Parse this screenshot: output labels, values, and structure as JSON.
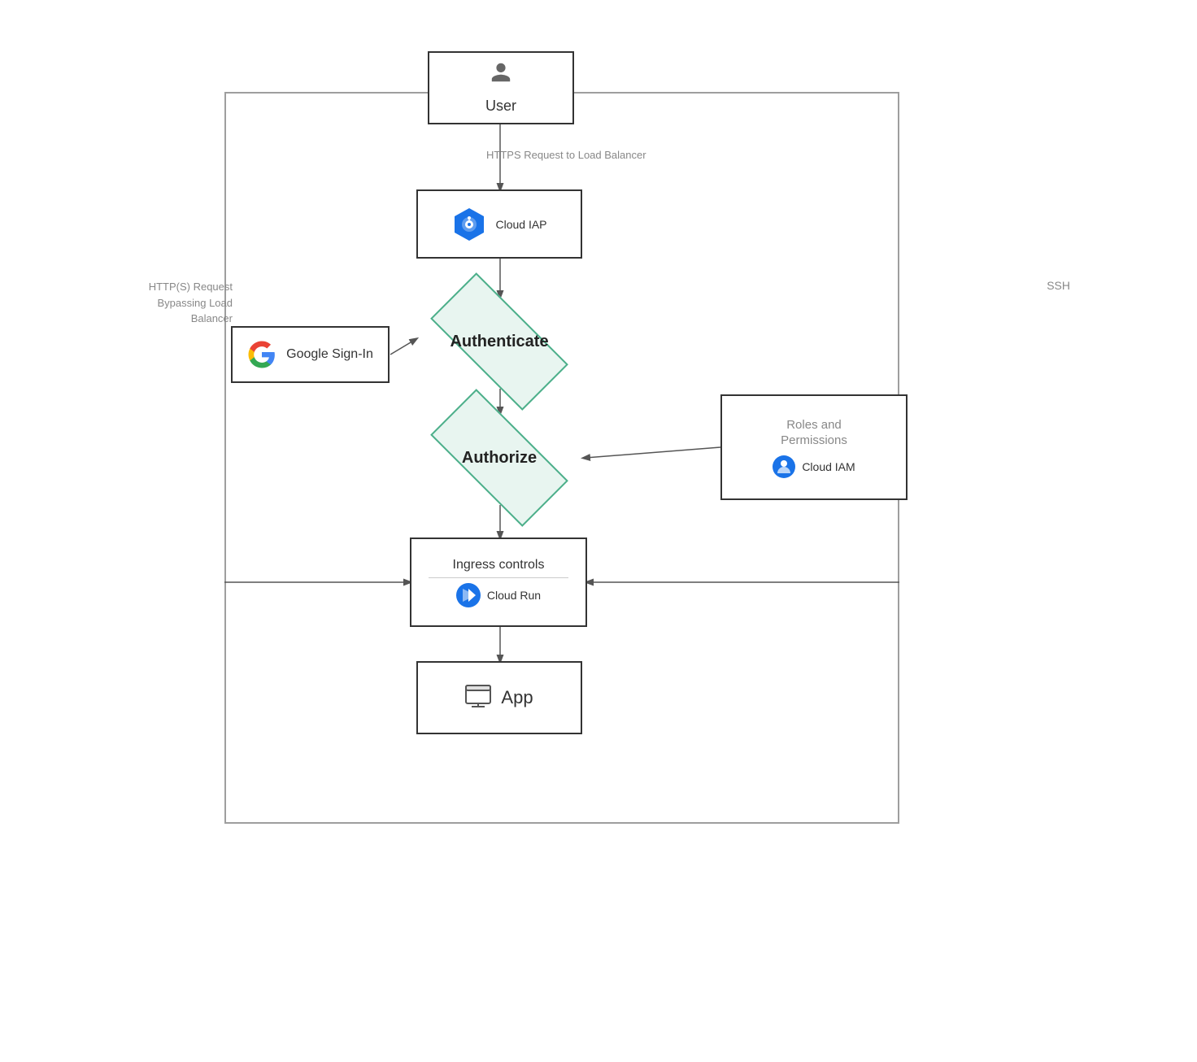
{
  "diagram": {
    "user": {
      "label": "User",
      "icon": "person"
    },
    "https_label": "HTTPS Request\nto Load Balancer",
    "cloud_iap": {
      "label": "Cloud IAP"
    },
    "authenticate": {
      "label": "Authenticate"
    },
    "authorize": {
      "label": "Authorize"
    },
    "ingress_controls": {
      "title": "Ingress controls",
      "service": "Cloud Run"
    },
    "app": {
      "label": "App"
    },
    "google_signin": {
      "label": "Google Sign-In"
    },
    "roles_permissions": {
      "title": "Roles and\nPermissions",
      "service": "Cloud IAM"
    },
    "http_bypass_label": "HTTP(S)\nRequest\nBypassing Load\nBalancer",
    "ssh_label": "SSH"
  }
}
